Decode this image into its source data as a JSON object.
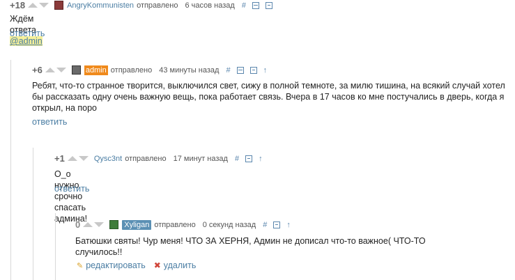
{
  "comments": [
    {
      "score": "+18",
      "author": "AngryKommunisten",
      "sent": "отправлено",
      "time": "6 часов назад",
      "text_prefix": "Ждём ответа ",
      "mention": "@admin",
      "reply": "ответить"
    },
    {
      "score": "+6",
      "author": "admin",
      "sent": "отправлено",
      "time": "43 минуты назад",
      "text": "Ребят, что-то странное творится, выключился свет, сижу в полной темноте, за милю тишина, на всякий случай хотел бы рассказать одну очень важную вещь, пока работает связь. Вчера в 17 часов ко мне постучались в дверь, когда я открыл, на поро",
      "reply": "ответить"
    },
    {
      "score": "+1",
      "author": "Qysc3nt",
      "sent": "отправлено",
      "time": "17 минут назад",
      "text": "О_о нужно срочно спасать админа!",
      "reply": "ответить"
    },
    {
      "score": "0",
      "author": "Xyligan",
      "sent": "отправлено",
      "time": "0 секунд назад",
      "text": "Батюшки святы! Чур меня! ЧТО ЗА ХЕРНЯ, Админ не дописал что-то важное( ЧТО-ТО случилось!!",
      "edit": "редактировать",
      "delete": "удалить"
    }
  ],
  "icons": {
    "hash": "#",
    "up_arrow": "↑"
  },
  "colors": {
    "link": "#4a7da3",
    "admin_badge": "#f08a1c",
    "xyligan_badge": "#5b90b4",
    "mention_bg": "#f5f09a"
  }
}
